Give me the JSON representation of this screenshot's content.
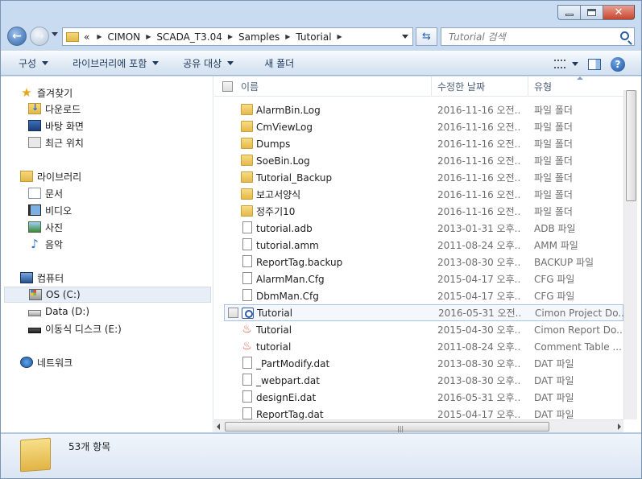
{
  "window": {
    "minimize": "─",
    "maximize": "□",
    "close": "✕"
  },
  "address": {
    "overflow": "«",
    "crumbs": [
      "CIMON",
      "SCADA_T3.04",
      "Samples",
      "Tutorial"
    ]
  },
  "search": {
    "placeholder": "Tutorial 검색"
  },
  "toolbar": {
    "organize": "구성",
    "include_library": "라이브러리에 포함",
    "share": "공유 대상",
    "new_folder": "새 폴더",
    "help": "?"
  },
  "nav": {
    "favorites": "즐겨찾기",
    "downloads": "다운로드",
    "desktop": "바탕 화면",
    "recent": "최근 위치",
    "libraries": "라이브러리",
    "documents": "문서",
    "videos": "비디오",
    "pictures": "사진",
    "music": "음악",
    "computer": "컴퓨터",
    "os_drive": "OS (C:)",
    "data_drive": "Data (D:)",
    "removable": "이동식 디스크 (E:)",
    "network": "네트워크"
  },
  "columns": {
    "name": "이름",
    "modified": "수정한 날짜",
    "type": "유형"
  },
  "files": [
    {
      "name": "AlarmBin.Log",
      "date": "2016-11-16 오전...",
      "type": "파일 폴더",
      "icon": "folder"
    },
    {
      "name": "CmViewLog",
      "date": "2016-11-16 오전...",
      "type": "파일 폴더",
      "icon": "folder"
    },
    {
      "name": "Dumps",
      "date": "2016-11-16 오전...",
      "type": "파일 폴더",
      "icon": "folder"
    },
    {
      "name": "SoeBin.Log",
      "date": "2016-11-16 오전...",
      "type": "파일 폴더",
      "icon": "folder"
    },
    {
      "name": "Tutorial_Backup",
      "date": "2016-11-16 오전...",
      "type": "파일 폴더",
      "icon": "folder"
    },
    {
      "name": "보고서양식",
      "date": "2016-11-16 오전...",
      "type": "파일 폴더",
      "icon": "folder"
    },
    {
      "name": "정주기10",
      "date": "2016-11-16 오전...",
      "type": "파일 폴더",
      "icon": "folder"
    },
    {
      "name": "tutorial.adb",
      "date": "2013-01-31 오후...",
      "type": "ADB 파일",
      "icon": "file"
    },
    {
      "name": "tutorial.amm",
      "date": "2011-08-24 오후...",
      "type": "AMM 파일",
      "icon": "file"
    },
    {
      "name": "ReportTag.backup",
      "date": "2013-08-30 오후...",
      "type": "BACKUP 파일",
      "icon": "file"
    },
    {
      "name": "AlarmMan.Cfg",
      "date": "2015-04-17 오후...",
      "type": "CFG 파일",
      "icon": "file"
    },
    {
      "name": "DbmMan.Cfg",
      "date": "2015-04-17 오후...",
      "type": "CFG 파일",
      "icon": "file"
    },
    {
      "name": "Tutorial",
      "date": "2016-05-31 오전...",
      "type": "Cimon Project Do...",
      "icon": "cimon"
    },
    {
      "name": "Tutorial",
      "date": "2015-04-30 오후...",
      "type": "Cimon Report Do...",
      "icon": "flame"
    },
    {
      "name": "tutorial",
      "date": "2011-08-24 오후...",
      "type": "Comment Table ...",
      "icon": "flame"
    },
    {
      "name": "_PartModify.dat",
      "date": "2013-08-30 오후...",
      "type": "DAT 파일",
      "icon": "file"
    },
    {
      "name": "_webpart.dat",
      "date": "2013-08-30 오후...",
      "type": "DAT 파일",
      "icon": "file"
    },
    {
      "name": "designEi.dat",
      "date": "2016-05-31 오후...",
      "type": "DAT 파일",
      "icon": "file"
    },
    {
      "name": "ReportTag.dat",
      "date": "2015-04-17 오후...",
      "type": "DAT 파일",
      "icon": "file"
    }
  ],
  "status": {
    "item_count": "53개 항목"
  }
}
